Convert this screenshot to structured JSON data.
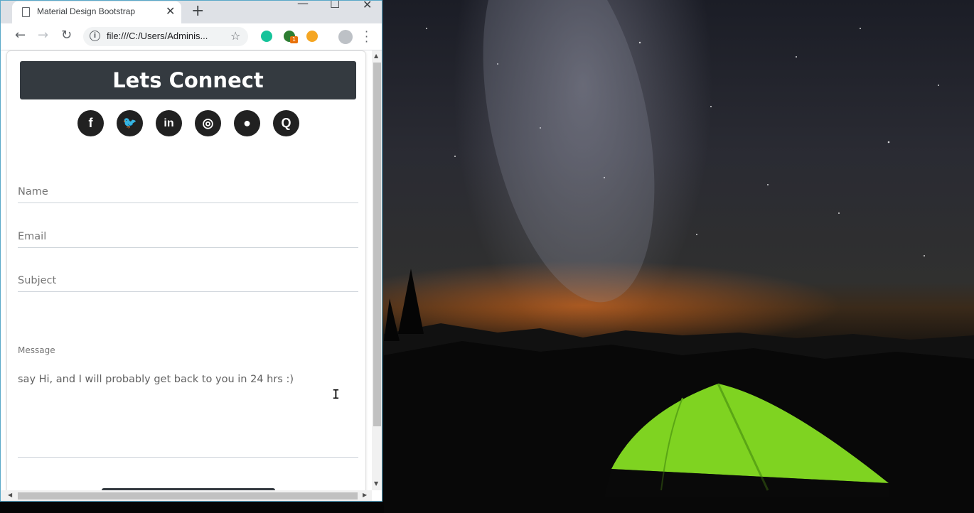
{
  "browser": {
    "tab_title": "Material Design Bootstrap",
    "tab_close": "✕",
    "new_tab": "+",
    "url": "file:///C:/Users/Adminis...",
    "extension_badge": "1"
  },
  "page": {
    "heading": "Lets Connect",
    "social_icons": [
      "facebook-icon",
      "twitter-icon",
      "linkedin-icon",
      "instagram-icon",
      "github-icon",
      "quora-icon"
    ],
    "social": {
      "facebook": "f",
      "twitter": "🐦",
      "linkedin": "in",
      "instagram": "◎",
      "github": "●",
      "quora": "Q"
    },
    "form": {
      "name_placeholder": "Name",
      "email_placeholder": "Email",
      "subject_placeholder": "Subject",
      "message_label": "Message",
      "message_placeholder": "say Hi, and I will probably get back to you in 24 hrs :)"
    }
  },
  "colors": {
    "header_bg": "#343a40",
    "icon_bg": "#212121",
    "window_border": "#5aa8c8"
  }
}
